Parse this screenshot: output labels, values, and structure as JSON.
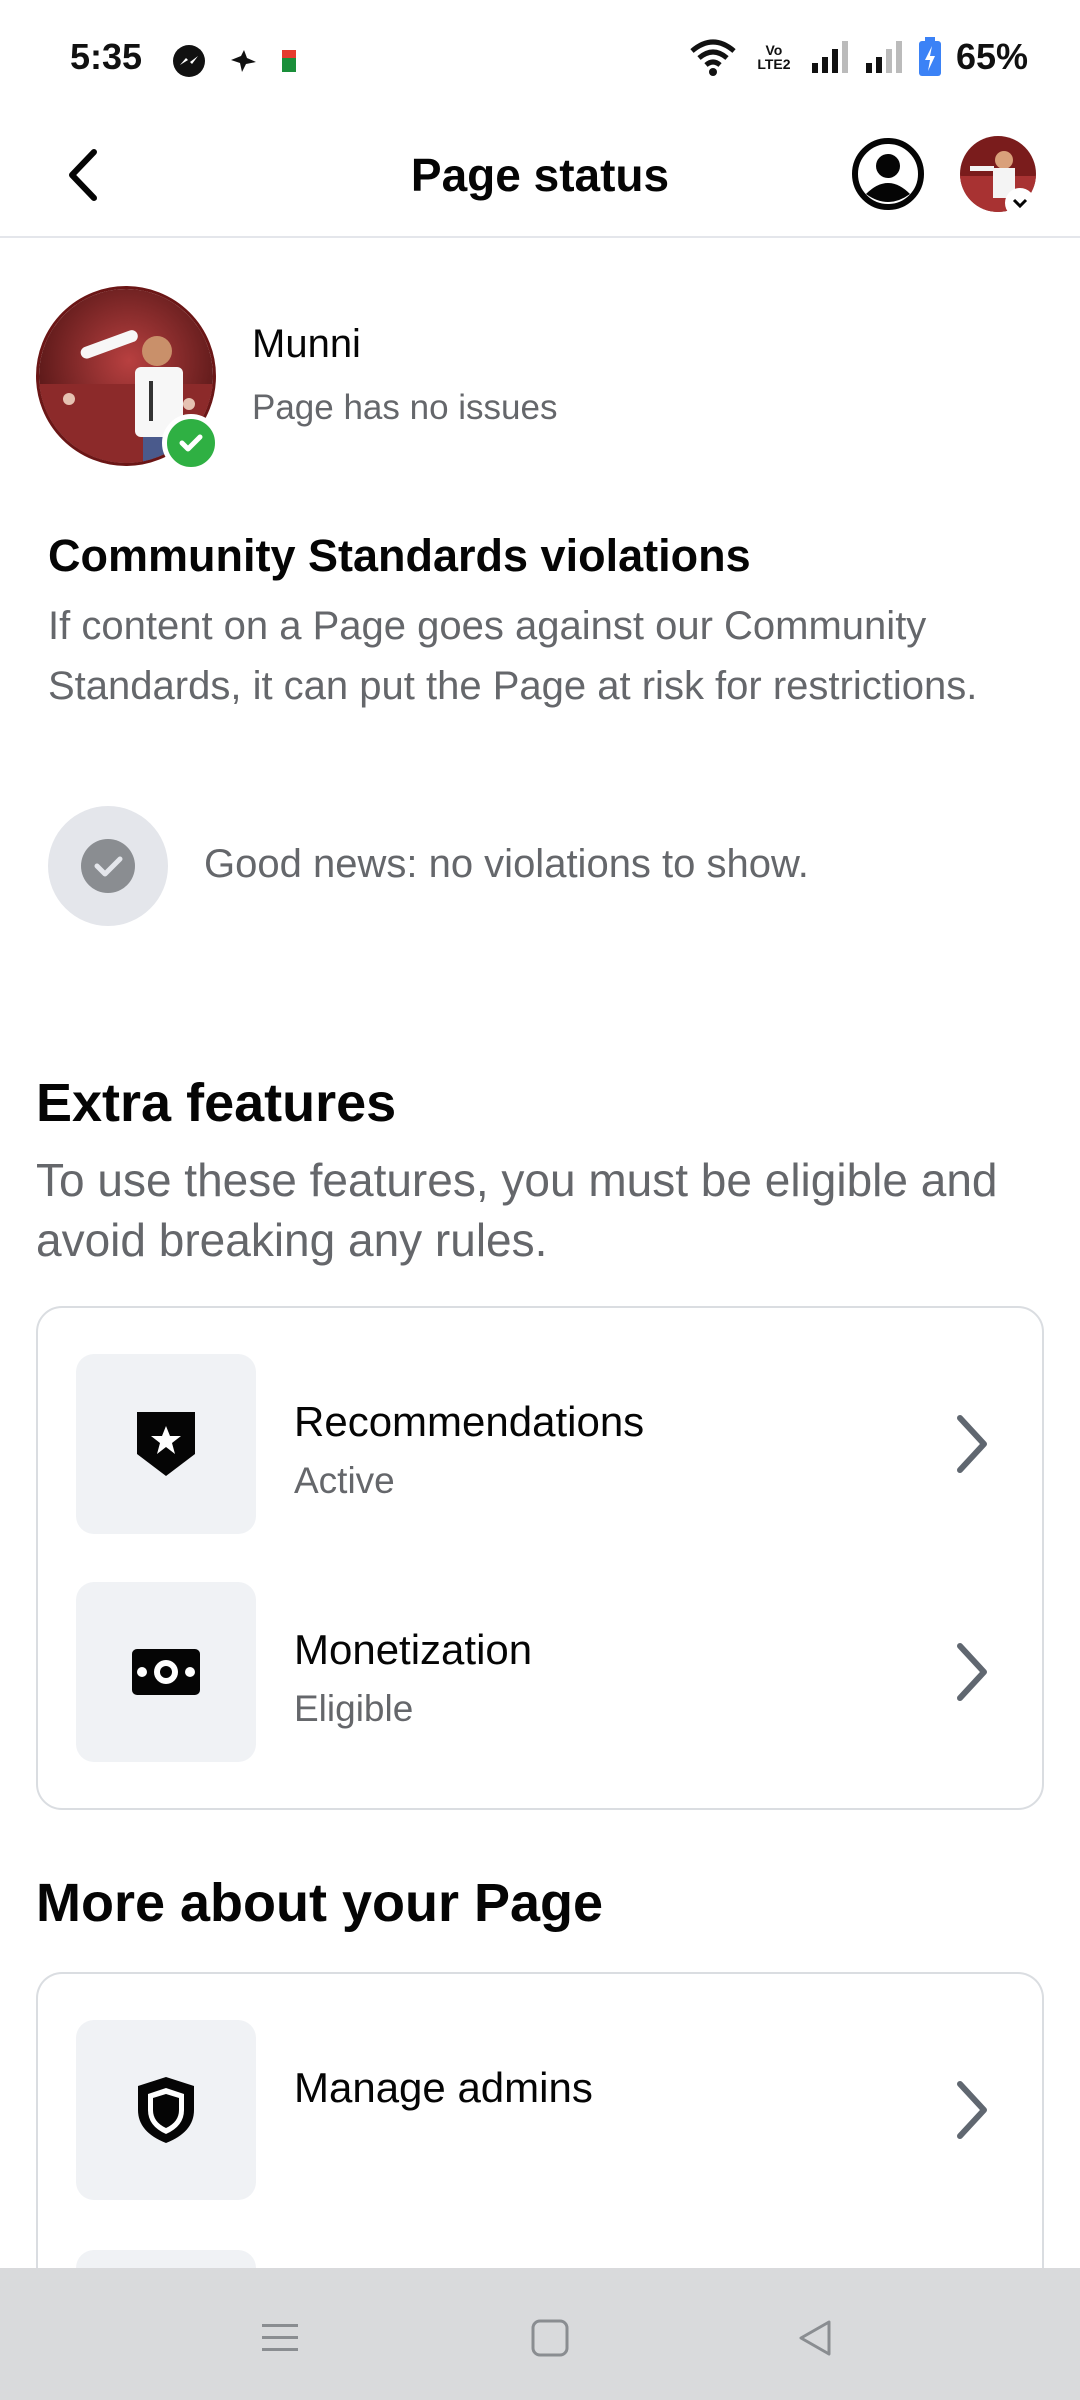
{
  "status_bar": {
    "time": "5:35",
    "battery": "65%",
    "network_label": "Vo LTE2"
  },
  "header": {
    "title": "Page status"
  },
  "page": {
    "name": "Munni",
    "status": "Page has no issues"
  },
  "community": {
    "title": "Community Standards violations",
    "description": "If content on a Page goes against our Community Standards, it can put the Page at risk for restrictions.",
    "good_news": "Good news: no violations to show."
  },
  "extra_features": {
    "title": "Extra features",
    "description": "To use these features, you must be eligible and avoid breaking any rules.",
    "items": [
      {
        "label": "Recommendations",
        "status": "Active",
        "icon": "star-shield-icon"
      },
      {
        "label": "Monetization",
        "status": "Eligible",
        "icon": "money-icon"
      }
    ]
  },
  "more_about": {
    "title": "More about your Page",
    "items": [
      {
        "label": "Manage admins",
        "icon": "shield-icon"
      }
    ]
  },
  "colors": {
    "primary_text": "#050505",
    "secondary_text": "#65676b",
    "success_green": "#2fb043",
    "icon_bg": "#f0f2f5",
    "nav_bar_bg": "#d9dadc"
  }
}
